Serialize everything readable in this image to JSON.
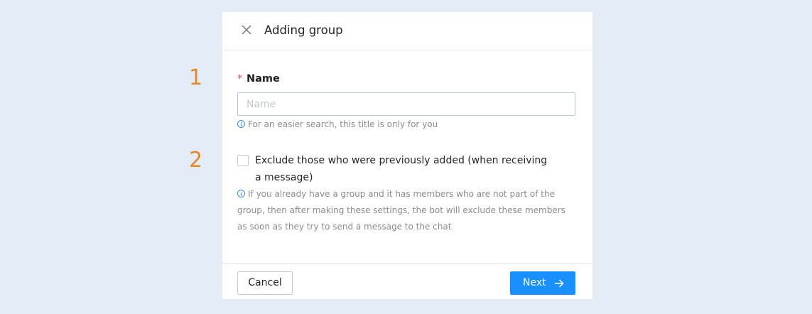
{
  "steps": [
    "1",
    "2"
  ],
  "dialog": {
    "title": "Adding group",
    "close_icon": "close-icon"
  },
  "name_field": {
    "label": "Name",
    "required_marker": "*",
    "placeholder": "Name",
    "value": "",
    "hint": "For an easier search, this title is only for you"
  },
  "exclude_option": {
    "label": "Exclude those who were previously added (when receiving a message)",
    "checked": false,
    "hint": "If you already have a group and it has members who are not part of the group, then after making these settings, the bot will exclude these members as soon as they try to send a message to the chat"
  },
  "footer": {
    "cancel_label": "Cancel",
    "next_label": "Next",
    "next_icon": "arrow-right-icon"
  },
  "colors": {
    "background": "#e3ebf5",
    "primary": "#1890ff",
    "step_number": "#e8872a",
    "required": "#e34d59",
    "info": "#3a8ee6"
  }
}
